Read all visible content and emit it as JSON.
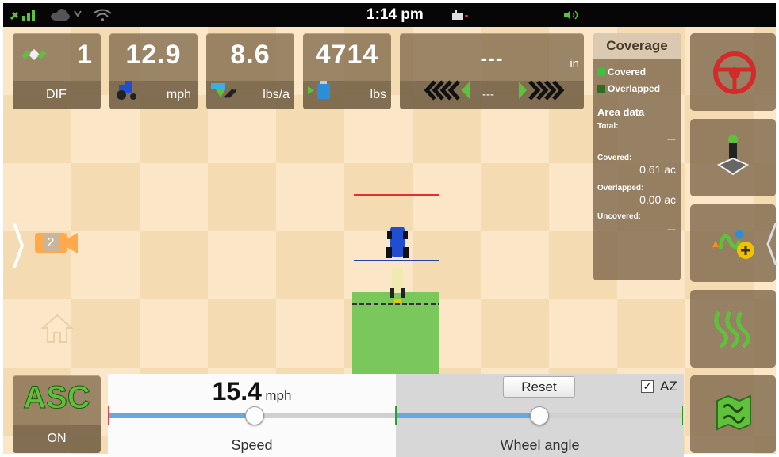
{
  "status_bar": {
    "time": "1:14 pm",
    "icons": [
      "gps-signal-icon",
      "cloud-sync-icon",
      "wifi-icon",
      "battery-icon",
      "volume-icon"
    ]
  },
  "tiles": {
    "satellites": {
      "value": "1",
      "label": "DIF",
      "icon": "satellite-icon"
    },
    "speed": {
      "value": "12.9",
      "unit": "mph",
      "icon": "tractor-icon"
    },
    "rate": {
      "value": "8.6",
      "unit": "lbs/a",
      "icon": "application-rate-icon"
    },
    "tank": {
      "value": "4714",
      "unit": "lbs",
      "icon": "tank-icon"
    },
    "offset": {
      "value": "---",
      "unit": "in",
      "center_value": "---",
      "icons": [
        "steer-left-chevrons-icon",
        "steer-right-chevrons-icon"
      ]
    }
  },
  "coverage": {
    "title": "Coverage",
    "legend": [
      "Covered",
      "Overlapped"
    ],
    "legend_colors": [
      "#3fbf3f",
      "#2f6b20"
    ],
    "area_data_title": "Area data",
    "total_label": "Total:",
    "total_value": "---",
    "covered_label": "Covered:",
    "covered_value": "0.61 ac",
    "overlapped_label": "Overlapped:",
    "overlapped_value": "0.00 ac",
    "uncovered_label": "Uncovered:",
    "uncovered_value": "---"
  },
  "left_controls": {
    "camera_number": "2",
    "icons": [
      "expand-left-chevron-icon",
      "camera-icon",
      "home-icon"
    ]
  },
  "right_buttons": [
    "steering-wheel-icon",
    "joystick-icon",
    "add-guidance-line-icon",
    "swath-lines-icon",
    "field-map-icon"
  ],
  "asc": {
    "title": "ASC",
    "state": "ON"
  },
  "sim": {
    "speed_value": "15.4",
    "speed_unit": "mph",
    "speed_label": "Speed",
    "speed_level": 0.51,
    "reset_label": "Reset",
    "az_checked": "✓",
    "az_label": "AZ",
    "wheel_label": "Wheel angle",
    "wheel_level": 0.5
  },
  "colors": {
    "accent_blue": "#2266dd",
    "coverage_green": "#7ac85c",
    "tile_brown": "#85704f"
  }
}
